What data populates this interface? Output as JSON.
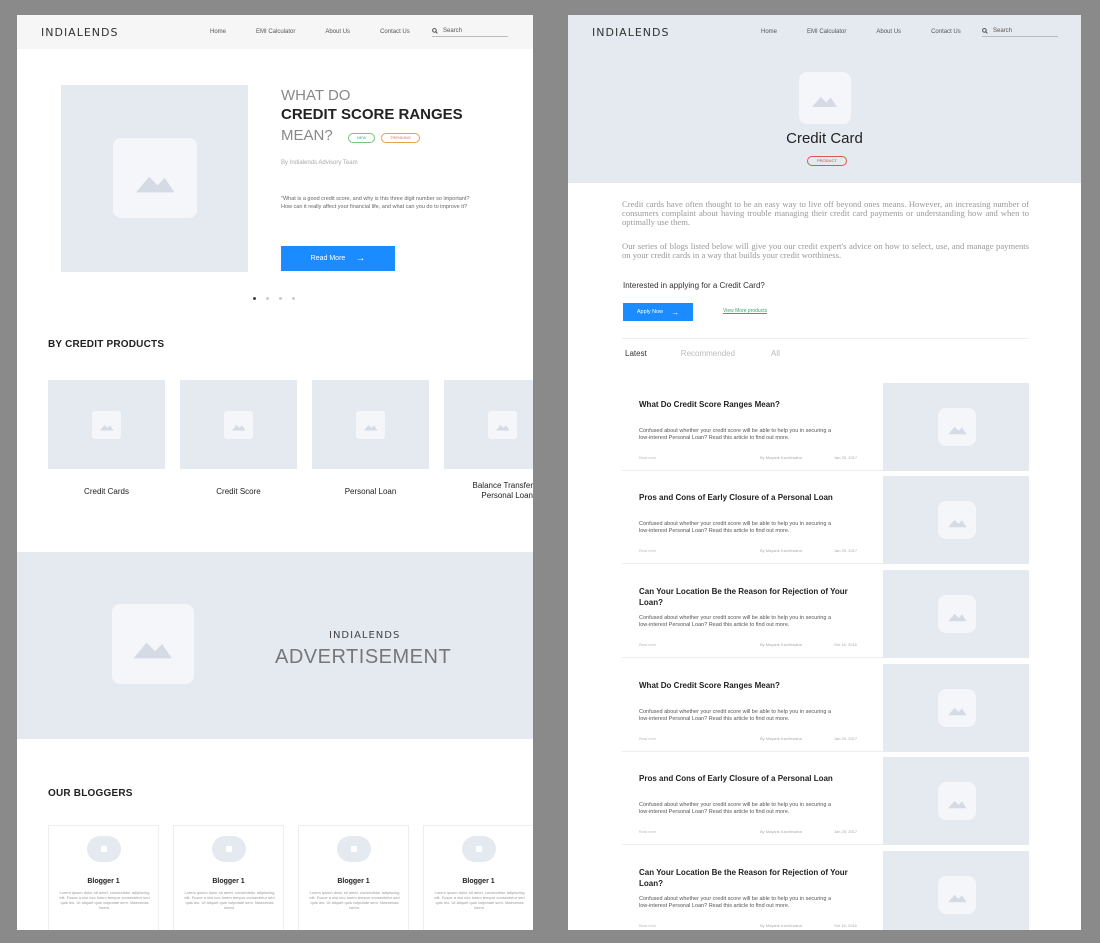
{
  "left": {
    "nav": {
      "logo": "INDIALENDS",
      "links": [
        "Home",
        "EMI Calculator",
        "About Us",
        "Contact Us"
      ],
      "search_placeholder": "Search"
    },
    "hero": {
      "title_line1": "WHAT DO",
      "title_line2": "CREDIT SCORE RANGES",
      "title_line3": "MEAN?",
      "tag_new": "NEW",
      "tag_trending": "TRENDING",
      "byline": "By Indialends Advisory Team",
      "description": "\"What is a good credit score, and why is this three digit number so important? How can it really affect your financial life, and what can you do to improve it?",
      "button_label": "Read More",
      "arrow": "→"
    },
    "credit_products": {
      "heading": "BY CREDIT PRODUCTS",
      "items": [
        "Credit Cards",
        "Credit Score",
        "Personal Loan",
        "Balance Transfer Personal Loan"
      ]
    },
    "advertisement": {
      "logo": "INDIALENDS",
      "text": "ADVERTISEMENT"
    },
    "bloggers": {
      "heading": "OUR BLOGGERS",
      "items": [
        {
          "name": "Blogger 1",
          "text": "Lorem ipsum dolor sit amet, consectetur adipiscing elit. Fusce a nisi nec lorem tempor consectetur sed quis leo. Ut aliquet quis vulputate sem. Maecenas lorem."
        },
        {
          "name": "Blogger 1",
          "text": "Lorem ipsum dolor sit amet, consectetur adipiscing elit. Fusce a nisi nec lorem tempor consectetur sed quis leo. Ut aliquet quis vulputate sem. Maecenas lorem."
        },
        {
          "name": "Blogger 1",
          "text": "Lorem ipsum dolor sit amet, consectetur adipiscing elit. Fusce a nisi nec lorem tempor consectetur sed quis leo. Ut aliquet quis vulputate sem. Maecenas lorem."
        },
        {
          "name": "Blogger 1",
          "text": "Lorem ipsum dolor sit amet, consectetur adipiscing elit. Fusce a nisi nec lorem tempor consectetur sed quis leo. Ut aliquet quis vulputate sem. Maecenas lorem."
        }
      ]
    }
  },
  "right": {
    "nav": {
      "logo": "INDIALENDS",
      "links": [
        "Home",
        "EMI Calculator",
        "About Us",
        "Contact Us"
      ],
      "search_placeholder": "Search"
    },
    "hero": {
      "title": "Credit Card",
      "tag": "PRODUCT"
    },
    "paragraph1": "Credit cards have often thought to be an easy way to live off beyond ones means. However, an increasing number of consumers complaint about having trouble managing their credit card payments or understanding how and when to optimally use them.",
    "paragraph2": "Our series of blogs listed below will give you our credit expert's advice on how to select, use, and manage payments on your credit cards in a way that builds your credit worthiness.",
    "question": "Interested in applying for a Credit Card?",
    "apply_button": "Apply Now",
    "arrow": "→",
    "view_more_link": "View More products",
    "tabs": [
      "Latest",
      "Recommended",
      "All"
    ],
    "articles": [
      {
        "title": "What Do Credit Score Ranges Mean?",
        "desc": "Confused about whether your credit score will be able to help you in securing a low-interest Personal Loan? Read this article to find out more.",
        "more": "Read more",
        "author": "By Mayank Kachhwaha",
        "date": "Jan 25, 2017"
      },
      {
        "title": "Pros and Cons of Early Closure of a Personal Loan",
        "desc": "Confused about whether your credit score will be able to help you in securing a low-interest Personal Loan? Read this article to find out more.",
        "more": "Read more",
        "author": "By Mayank Kachhwaha",
        "date": "Jan 25, 2017"
      },
      {
        "title": "Can Your Location Be the Reason for Rejection of Your Loan?",
        "desc": "Confused about whether your credit score will be able to help you in securing a low-interest Personal Loan? Read this article to find out more.",
        "more": "Read more",
        "author": "By Mayank Kachhwaha",
        "date": "Oct 16, 2016"
      },
      {
        "title": "What Do Credit Score Ranges Mean?",
        "desc": "Confused about whether your credit score will be able to help you in securing a low-interest Personal Loan? Read this article to find out more.",
        "more": "Read more",
        "author": "By Mayank Kachhwaha",
        "date": "Jan 25, 2017"
      },
      {
        "title": "Pros and Cons of Early Closure of a Personal Loan",
        "desc": "Confused about whether your credit score will be able to help you in securing a low-interest Personal Loan? Read this article to find out more.",
        "more": "Read more",
        "author": "By Mayank Kachhwaha",
        "date": "Jan 25, 2017"
      },
      {
        "title": "Can Your Location Be the Reason for Rejection of Your Loan?",
        "desc": "Confused about whether your credit score will be able to help you in securing a low-interest Personal Loan? Read this article to find out more.",
        "more": "Read more",
        "author": "By Mayank Kachhwaha",
        "date": "Oct 16, 2016"
      }
    ]
  },
  "colors": {
    "accent": "#1a8cff",
    "placeholder": "#e5e9f0",
    "link": "#3aa574"
  }
}
